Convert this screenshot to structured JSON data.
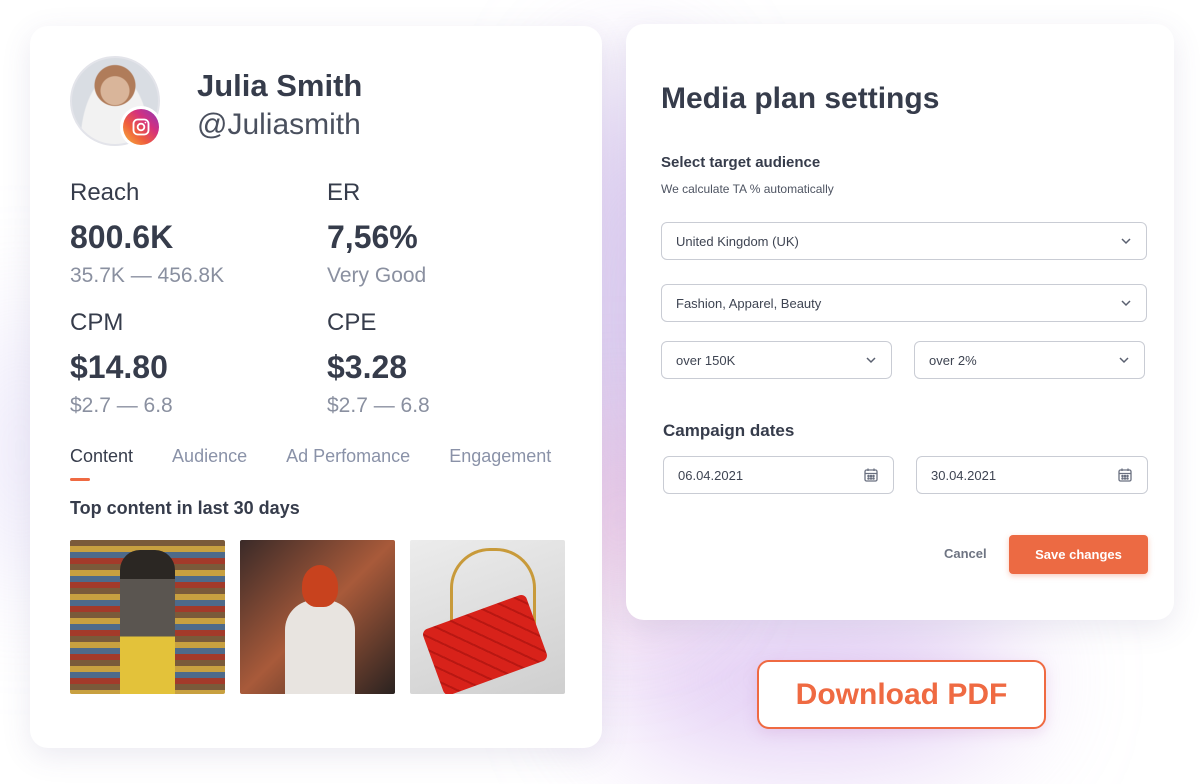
{
  "profile": {
    "name": "Julia Smith",
    "handle": "@Juliasmith",
    "avatar_icon": "user-avatar",
    "badge_icon": "instagram-icon",
    "metrics": [
      {
        "label": "Reach",
        "value": "800.6K",
        "sub": "35.7K — 456.8K"
      },
      {
        "label": "ER",
        "value": "7,56%",
        "sub": "Very Good"
      },
      {
        "label": "CPM",
        "value": "$14.80",
        "sub": "$2.7 — 6.8"
      },
      {
        "label": "CPE",
        "value": "$3.28",
        "sub": "$2.7 — 6.8"
      }
    ],
    "tabs": [
      {
        "label": "Content",
        "active": true
      },
      {
        "label": "Audience",
        "active": false
      },
      {
        "label": "Ad Perfomance",
        "active": false
      },
      {
        "label": "Engagement",
        "active": false
      }
    ],
    "top_content_title": "Top content in last 30 days"
  },
  "plan": {
    "title": "Media plan settings",
    "audience_label": "Select target audience",
    "audience_hint": "We calculate TA % automatically",
    "country": "United Kingdom (UK)",
    "interests": "Fashion, Apparel, Beauty",
    "followers": "over 150K",
    "er": "over 2%",
    "dates_label": "Campaign dates",
    "start_date": "06.04.2021",
    "end_date": "30.04.2021",
    "cancel_label": "Cancel",
    "save_label": "Save changes"
  },
  "download_label": "Download PDF",
  "colors": {
    "accent": "#ec6a43",
    "text_dark": "#363c4b",
    "text_muted": "#8a90a0"
  }
}
